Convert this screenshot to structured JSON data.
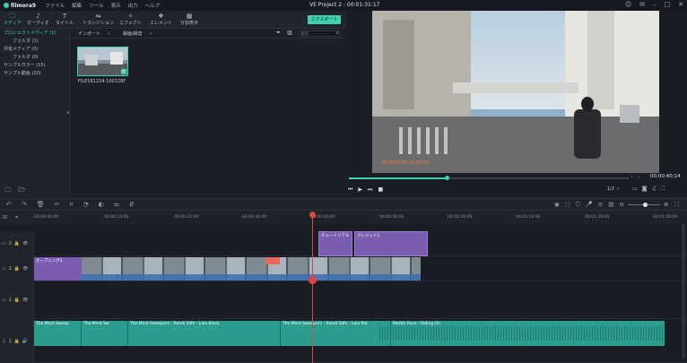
{
  "app": {
    "name": "filmora9",
    "window_title": "VE Project 2 : 00:01:31:17"
  },
  "menu": [
    "ファイル",
    "編集",
    "ツール",
    "表示",
    "出力",
    "ヘルプ"
  ],
  "toolbar": {
    "tabs": [
      "メディア",
      "オーディオ",
      "タイトル",
      "トランジション",
      "エフェクト",
      "エレメント",
      "分割表示"
    ],
    "export_label": "エクスポート"
  },
  "sidebar": {
    "items": [
      {
        "label": "プロジェクトメディア (1)"
      },
      {
        "label": "フォルダ (1)"
      },
      {
        "label": "共有メディア (0)"
      },
      {
        "label": "フォルダ (0)"
      },
      {
        "label": "サンプルカラー (15)"
      },
      {
        "label": "サンプル動画 (20)"
      }
    ]
  },
  "library": {
    "import_label": "インポート",
    "filter_label": "録画/録音",
    "search_placeholder": "検索",
    "media": [
      {
        "name": "FILE181224-100128F"
      }
    ]
  },
  "preview": {
    "timestamp": "00:00:40:14",
    "overlay_text": "2018/12/24 10:15:32",
    "quality": "1/2",
    "progress": 0.35
  },
  "timeline": {
    "ruler": [
      "00:00:00:00",
      "00:00:10:00",
      "00:00:20:00",
      "00:00:30:00",
      "00:00:40:00",
      "00:00:50:00",
      "00:01:00:00",
      "00:01:10:00",
      "00:01:20:00",
      "00:01:30:00"
    ],
    "tracks": {
      "t3": {
        "label": "3"
      },
      "t2": {
        "label": "2"
      },
      "t1": {
        "label": "1"
      },
      "a1": {
        "label": "1"
      }
    },
    "clips": {
      "title1": "チュートリアル",
      "title2": "クレジット1",
      "opener": "オープニング2",
      "audio1": "The Mind Sweep",
      "audio2": "The Mind Sw",
      "audio3": "The Mind Sweepers - Randi Slife - Lala Black",
      "audio4": "The Mind Sweepers - Randi Slife - Lala Bla",
      "audio5": "Martin Rose - Riding On"
    }
  },
  "colors": {
    "accent": "#3fd1b0",
    "playhead": "#e0463f",
    "title_clip": "#7a5cb0",
    "audio_clip": "#2a9d8f",
    "video_clip": "#3a6fb0"
  }
}
